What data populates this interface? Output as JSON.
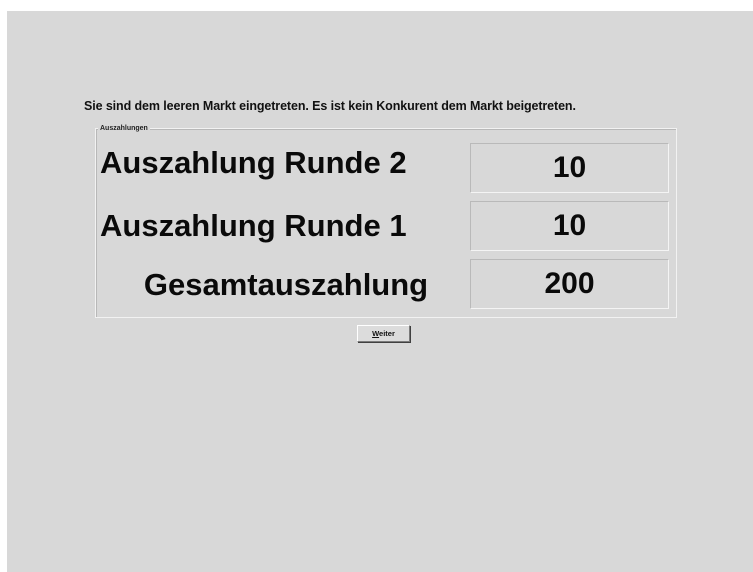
{
  "message": "Sie sind dem leeren Markt eingetreten. Es ist kein Konkurent dem Markt beigetreten.",
  "payout_group": {
    "title": "Auszahlungen",
    "rows": [
      {
        "label": "Auszahlung Runde 2",
        "value": "10"
      },
      {
        "label": "Auszahlung Runde 1",
        "value": "10"
      },
      {
        "label": "Gesamtauszahlung",
        "value": "200"
      }
    ]
  },
  "next_button": {
    "mnemonic": "W",
    "label_rest": "eiter"
  }
}
